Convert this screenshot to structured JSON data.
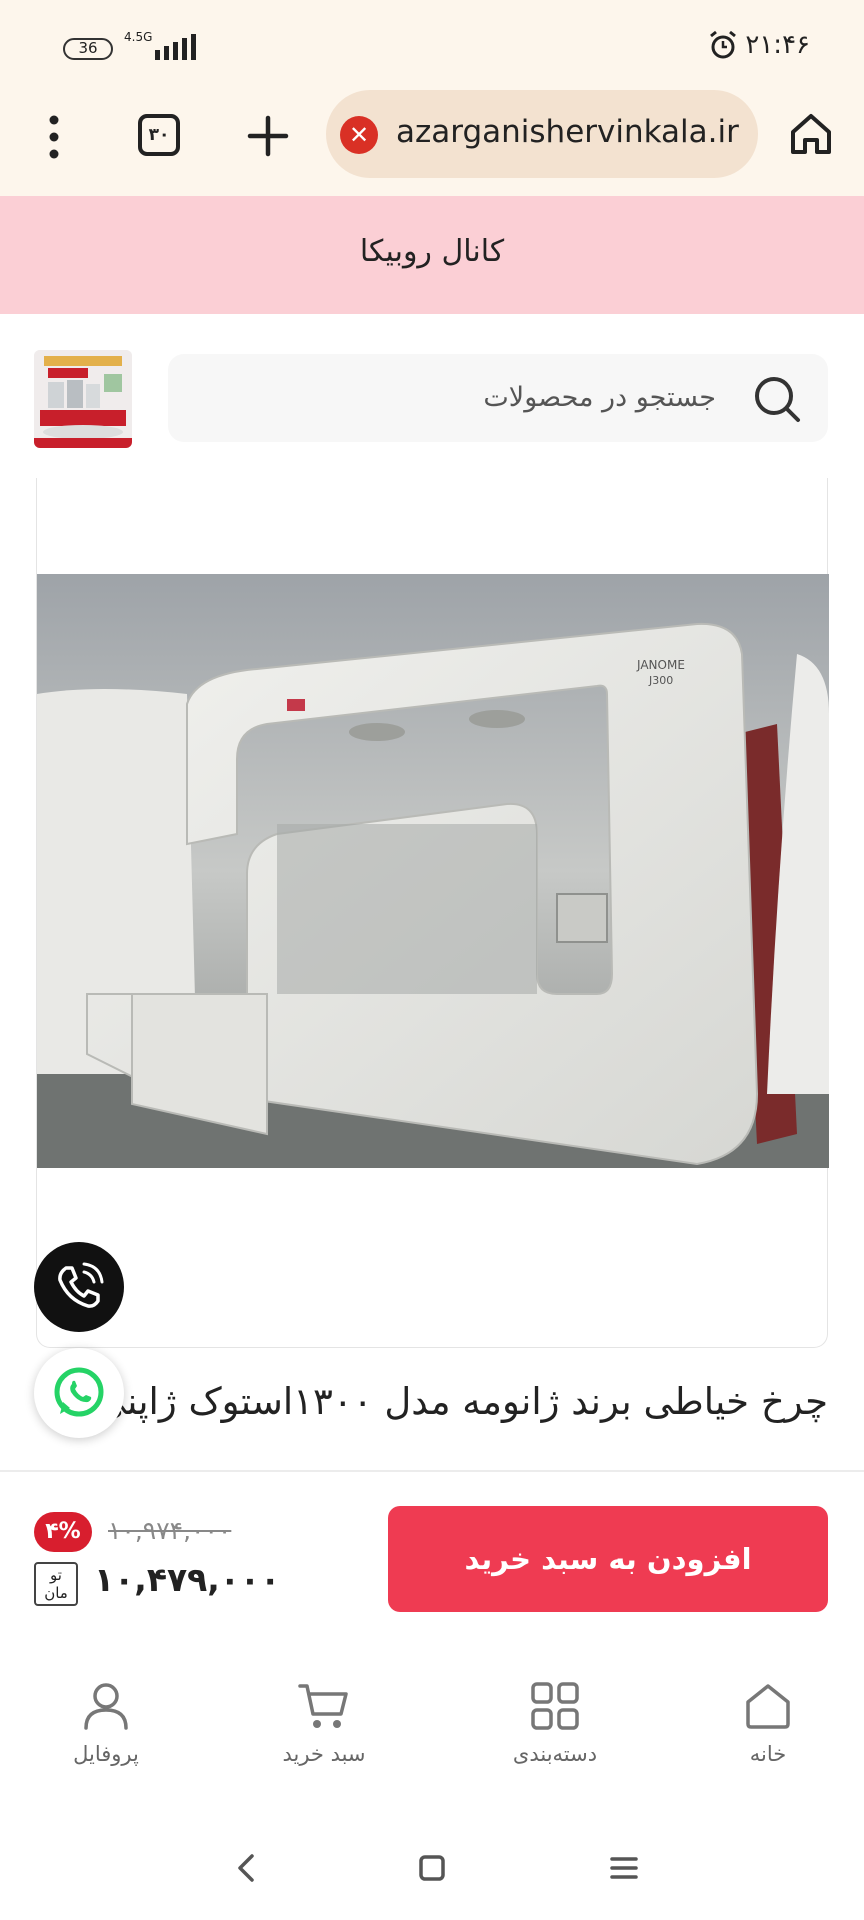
{
  "status_bar": {
    "battery": "36",
    "network": "4.5G",
    "time": "۲۱:۴۶",
    "icons": [
      "alarm-icon",
      "signal-icon"
    ]
  },
  "browser": {
    "tab_count": "۳۰",
    "url": "azarganishervinkala.ir",
    "icons": [
      "menu-icon",
      "tabs-icon",
      "plus-icon",
      "insecure-icon",
      "home-icon"
    ]
  },
  "banner": {
    "label": "کانال روبیکا"
  },
  "search": {
    "placeholder": "جستجو در محصولات"
  },
  "product": {
    "title": "چرخ خیاطی برند ژانومه مدل ۱۳۰۰استوک ژاپنی",
    "discount": "۴%",
    "old_price": "۱۰,۹۷۴,۰۰۰",
    "price": "۱۰,۴۷۹,۰۰۰",
    "currency": "تومان",
    "currency_line1": "تو",
    "currency_line2": "مان"
  },
  "actions": {
    "add_to_cart": "افزودن به سبد خرید"
  },
  "bottom_nav": {
    "home": "خانه",
    "categories": "دسته‌بندی",
    "cart": "سبد خرید",
    "profile": "پروفایل"
  },
  "colors": {
    "accent": "#ef3b52",
    "banner": "#fbcfd5",
    "discount_badge": "#d81e2e",
    "browser_bar": "#fdf6ec"
  }
}
